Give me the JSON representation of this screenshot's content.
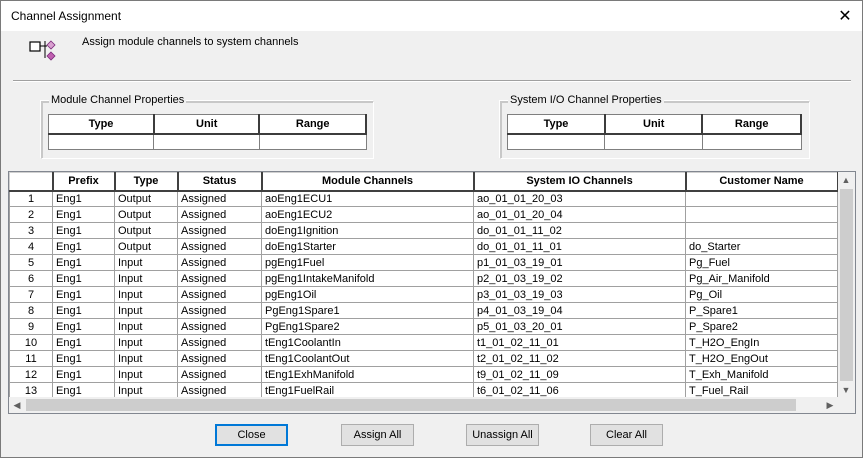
{
  "window": {
    "title": "Channel Assignment",
    "close_glyph": "✕"
  },
  "header": {
    "description": "Assign module channels to system channels",
    "icon": "channel-assign-icon"
  },
  "module_props": {
    "label": "Module Channel Properties",
    "columns": [
      "Type",
      "Unit",
      "Range"
    ]
  },
  "system_props": {
    "label": "System I/O Channel Properties",
    "columns": [
      "Type",
      "Unit",
      "Range"
    ]
  },
  "grid": {
    "columns": [
      "Prefix",
      "Type",
      "Status",
      "Module Channels",
      "System IO Channels",
      "Customer Name"
    ],
    "rows": [
      {
        "n": "1",
        "prefix": "Eng1",
        "type": "Output",
        "status": "Assigned",
        "module": "aoEng1ECU1",
        "system": "ao_01_01_20_03",
        "customer": ""
      },
      {
        "n": "2",
        "prefix": "Eng1",
        "type": "Output",
        "status": "Assigned",
        "module": "aoEng1ECU2",
        "system": "ao_01_01_20_04",
        "customer": ""
      },
      {
        "n": "3",
        "prefix": "Eng1",
        "type": "Output",
        "status": "Assigned",
        "module": "doEng1Ignition",
        "system": "do_01_01_11_02",
        "customer": ""
      },
      {
        "n": "4",
        "prefix": "Eng1",
        "type": "Output",
        "status": "Assigned",
        "module": "doEng1Starter",
        "system": "do_01_01_11_01",
        "customer": "do_Starter"
      },
      {
        "n": "5",
        "prefix": "Eng1",
        "type": "Input",
        "status": "Assigned",
        "module": "pgEng1Fuel",
        "system": "p1_01_03_19_01",
        "customer": "Pg_Fuel"
      },
      {
        "n": "6",
        "prefix": "Eng1",
        "type": "Input",
        "status": "Assigned",
        "module": "pgEng1IntakeManifold",
        "system": "p2_01_03_19_02",
        "customer": "Pg_Air_Manifold"
      },
      {
        "n": "7",
        "prefix": "Eng1",
        "type": "Input",
        "status": "Assigned",
        "module": "pgEng1Oil",
        "system": "p3_01_03_19_03",
        "customer": "Pg_Oil"
      },
      {
        "n": "8",
        "prefix": "Eng1",
        "type": "Input",
        "status": "Assigned",
        "module": "PgEng1Spare1",
        "system": "p4_01_03_19_04",
        "customer": "P_Spare1"
      },
      {
        "n": "9",
        "prefix": "Eng1",
        "type": "Input",
        "status": "Assigned",
        "module": "PgEng1Spare2",
        "system": "p5_01_03_20_01",
        "customer": "P_Spare2"
      },
      {
        "n": "10",
        "prefix": "Eng1",
        "type": "Input",
        "status": "Assigned",
        "module": "tEng1CoolantIn",
        "system": "t1_01_02_11_01",
        "customer": "T_H2O_EngIn"
      },
      {
        "n": "11",
        "prefix": "Eng1",
        "type": "Input",
        "status": "Assigned",
        "module": "tEng1CoolantOut",
        "system": "t2_01_02_11_02",
        "customer": "T_H2O_EngOut"
      },
      {
        "n": "12",
        "prefix": "Eng1",
        "type": "Input",
        "status": "Assigned",
        "module": "tEng1ExhManifold",
        "system": "t9_01_02_11_09",
        "customer": "T_Exh_Manifold"
      },
      {
        "n": "13",
        "prefix": "Eng1",
        "type": "Input",
        "status": "Assigned",
        "module": "tEng1FuelRail",
        "system": "t6_01_02_11_06",
        "customer": "T_Fuel_Rail"
      }
    ]
  },
  "buttons": {
    "close": "Close",
    "assign_all": "Assign All",
    "unassign_all": "Unassign All",
    "clear_all": "Clear All"
  },
  "scrollbar": {
    "up": "▲",
    "down": "▼",
    "left": "◀",
    "right": "▶"
  }
}
